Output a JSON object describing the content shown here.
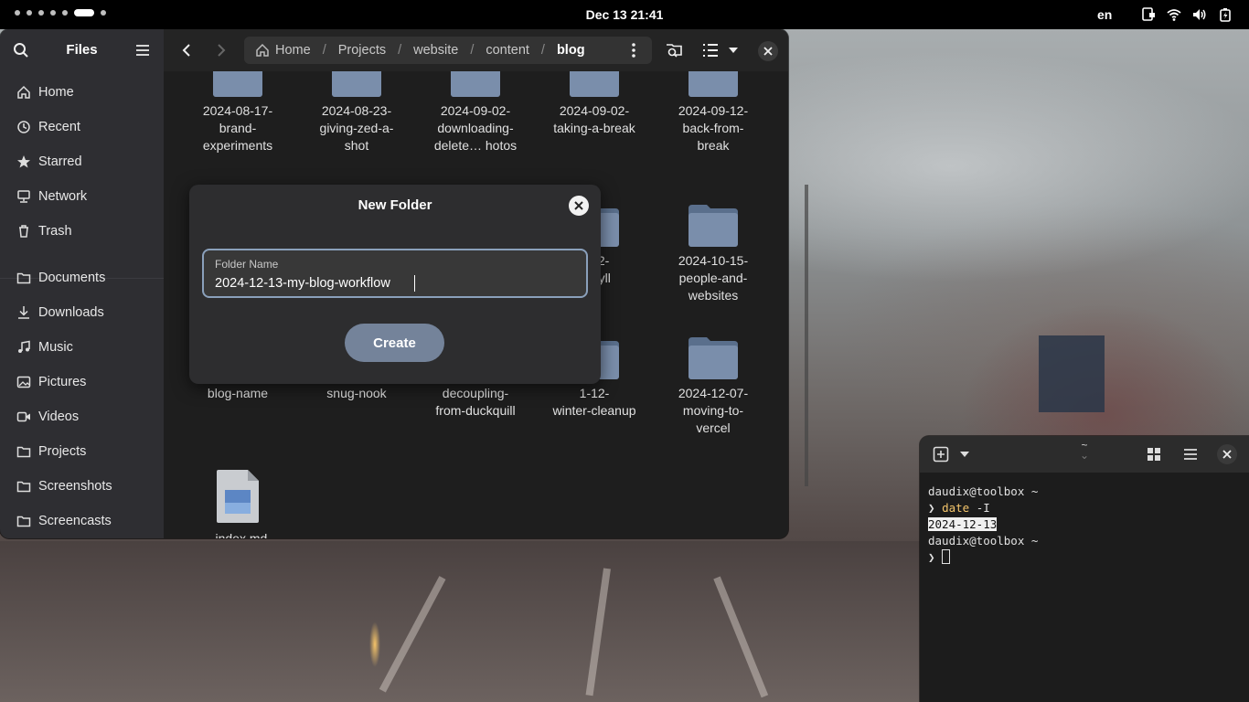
{
  "topbar": {
    "clock": "Dec 13  21:41",
    "language": "en"
  },
  "files": {
    "title": "Files",
    "sidebar": {
      "items": [
        {
          "label": "Home",
          "icon": "home-icon"
        },
        {
          "label": "Recent",
          "icon": "clock-icon"
        },
        {
          "label": "Starred",
          "icon": "star-icon"
        },
        {
          "label": "Network",
          "icon": "network-icon"
        },
        {
          "label": "Trash",
          "icon": "trash-icon"
        },
        {
          "label": "Documents",
          "icon": "folder-icon"
        },
        {
          "label": "Downloads",
          "icon": "download-icon"
        },
        {
          "label": "Music",
          "icon": "music-icon"
        },
        {
          "label": "Pictures",
          "icon": "picture-icon"
        },
        {
          "label": "Videos",
          "icon": "video-icon"
        },
        {
          "label": "Projects",
          "icon": "folder-icon"
        },
        {
          "label": "Screenshots",
          "icon": "folder-icon"
        },
        {
          "label": "Screencasts",
          "icon": "folder-icon"
        }
      ]
    },
    "breadcrumb": [
      "Home",
      "Projects",
      "website",
      "content",
      "blog"
    ],
    "grid": {
      "row1": [
        "2024-08-17-\nbrand-\nexperiments",
        "2024-08-23-\ngiving-zed-a-\nshot",
        "2024-09-02-\ndownloading-\ndelete… hotos",
        "2024-09-02-\ntaking-a-break",
        "2024-09-12-\nback-from-\nbreak"
      ],
      "row2_partial": [
        "0-12-\n-jekyll"
      ],
      "row2_last": "2024-10-15-\npeople-and-\nwebsites",
      "row3": [
        "blog-name",
        "snug-nook",
        "decoupling-\nfrom-duckquill",
        "1-12-\nwinter-cleanup",
        "2024-12-07-\nmoving-to-\nvercel"
      ],
      "row4": [
        "_index.md"
      ]
    }
  },
  "dialog": {
    "title": "New Folder",
    "field_label": "Folder Name",
    "field_value": "2024-12-13-my-blog-workflow",
    "create_label": "Create"
  },
  "terminal": {
    "title_glyph": "~",
    "lines": {
      "prompt1": "daudix@toolbox ~",
      "cmd_prefix": "❯ ",
      "cmd_name": "date",
      "cmd_args": " -I",
      "output": "2024-12-13",
      "prompt2": "daudix@toolbox ~",
      "prompt_sym": "❯ "
    }
  }
}
